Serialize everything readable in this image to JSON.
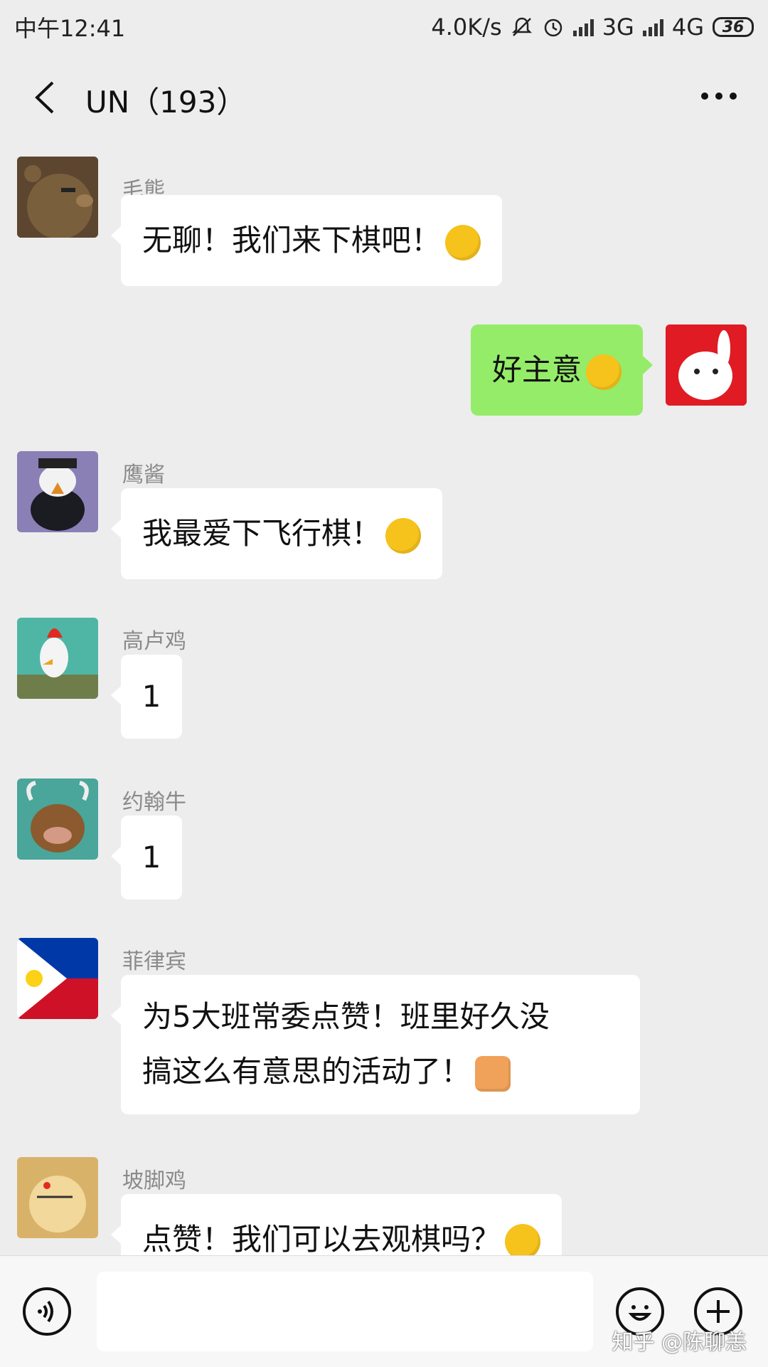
{
  "status_bar": {
    "time": "中午12:41",
    "speed": "4.0K/s",
    "net1": "3G",
    "net2": "4G",
    "battery": "36"
  },
  "header": {
    "title": "UN（193）"
  },
  "messages": [
    {
      "side": "left",
      "sender": "毛熊",
      "text": "无聊！我们来下棋吧！",
      "emoji": "grin-emoji",
      "avatar": "bear-avatar"
    },
    {
      "side": "right",
      "text": "好主意",
      "emoji": "sunglasses-emoji",
      "avatar": "rabbit-avatar"
    },
    {
      "side": "left",
      "sender": "鹰酱",
      "text": "我最爱下飞行棋！",
      "emoji": "happy-emoji",
      "avatar": "eagle-avatar"
    },
    {
      "side": "left",
      "sender": "高卢鸡",
      "text": "1",
      "avatar": "rooster-avatar"
    },
    {
      "side": "left",
      "sender": "约翰牛",
      "text": "1",
      "avatar": "bull-avatar"
    },
    {
      "side": "left",
      "sender": "菲律宾",
      "line1": "为5大班常委点赞！班里好久没",
      "line2": "搞这么有意思的活动了！",
      "emoji": "thumbs-up-emoji",
      "avatar": "philippines-flag-avatar"
    },
    {
      "side": "left",
      "sender": "坡脚鸡",
      "text": "点赞！我们可以去观棋吗？",
      "emoji": "heart-eyes-emoji",
      "avatar": "chicken-avatar"
    }
  ],
  "input_bar": {
    "placeholder": ""
  },
  "watermark": "知乎 @陈聊恙",
  "colors": {
    "background": "#ededed",
    "own_bubble": "#95ec69",
    "other_bubble": "#ffffff"
  }
}
